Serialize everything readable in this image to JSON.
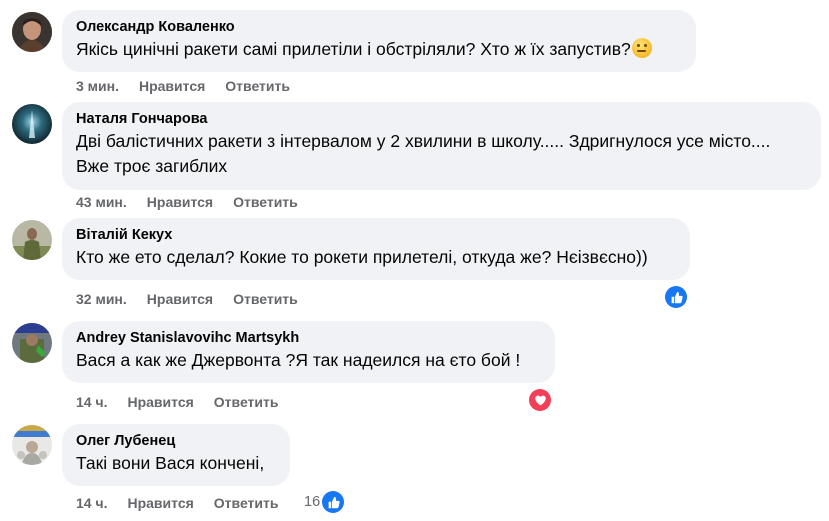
{
  "comments": [
    {
      "author": "Олександр Коваленко",
      "text": "Якісь цинічні ракети самі прилетіли і обстріляли? Хто ж їх запустив?",
      "emoji": "thinking-face-emoji",
      "time": "3 мин.",
      "like": "Нравится",
      "reply": "Ответить"
    },
    {
      "author": "Наталя Гончарова",
      "text": "Дві балістичних ракети з інтервалом у 2 хвилини в школу..... Здригнулося усе місто....\nВже троє загиблих",
      "time": "43 мин.",
      "like": "Нравится",
      "reply": "Ответить"
    },
    {
      "author": "Віталій Кекух",
      "text": "Кто же ето сделал? Кокие то рокети прилетелі, откуда же? Нєізвєсно))",
      "time": "32 мин.",
      "like": "Нравится",
      "reply": "Ответить",
      "reaction": {
        "icon": "thumbs-up-icon",
        "color": "#1877f2",
        "count": ""
      }
    },
    {
      "author": "Andrey Stanislavovihc Martsykh",
      "text": "Вася а как же Джервонта ?Я так надеился на єто бой !",
      "time": "14 ч.",
      "like": "Нравится",
      "reply": "Ответить",
      "reaction": {
        "icon": "heart-icon",
        "color": "#f33e58",
        "count": ""
      }
    },
    {
      "author": "Олег Лубенец",
      "text": "Такі вони Вася кончені,",
      "time": "14 ч.",
      "like": "Нравится",
      "reply": "Ответить",
      "reaction": {
        "icon": "thumbs-up-icon",
        "color": "#1877f2",
        "count": "16"
      }
    }
  ]
}
